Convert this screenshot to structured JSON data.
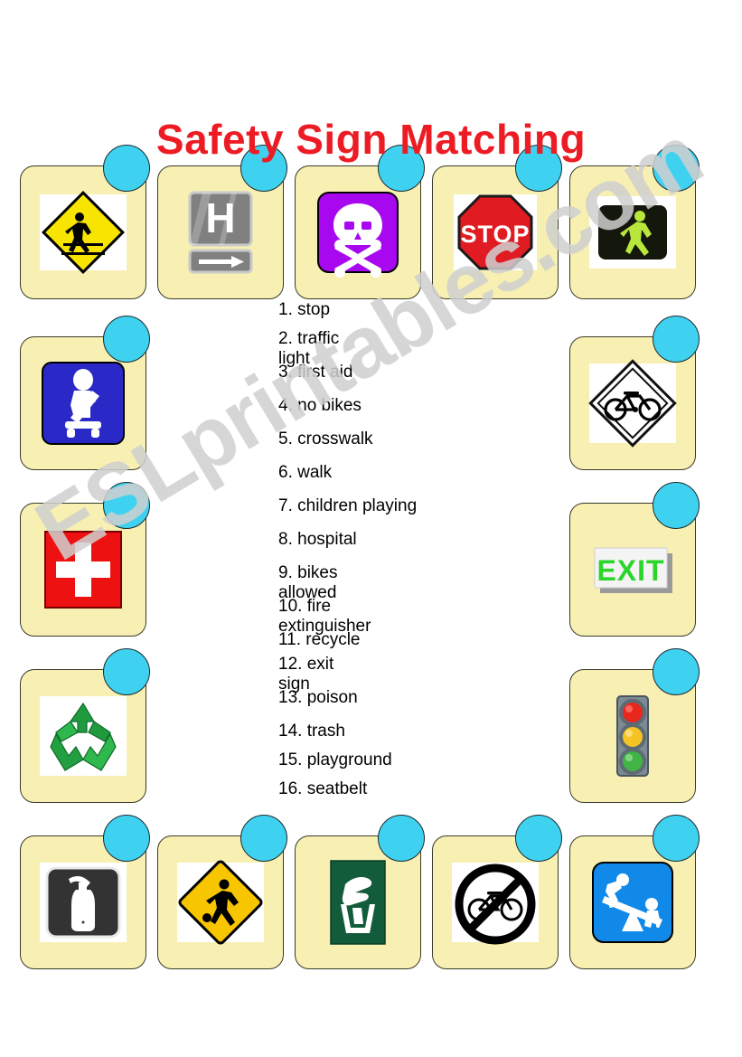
{
  "page": {
    "title": "Safety Sign Matching",
    "title_color": "#ED1C24",
    "background_color": "#ffffff",
    "watermark": "ESLprintables.com",
    "watermark_color": "#d0d0d0",
    "tile_color": "#F7F0B2",
    "bubble_color": "#3FD2F0"
  },
  "word_list": [
    {
      "num": "1.",
      "text": "stop"
    },
    {
      "num": "2.",
      "text": "traffic",
      "text2": "light"
    },
    {
      "num": "3.",
      "text": "first aid"
    },
    {
      "num": "4.",
      "text": "no bikes"
    },
    {
      "num": "5.",
      "text": "crosswalk"
    },
    {
      "num": "6.",
      "text": "walk"
    },
    {
      "num": "7.",
      "text": "children playing"
    },
    {
      "num": "8.",
      "text": "hospital"
    },
    {
      "num": "9.",
      "text": "bikes",
      "text2": "allowed"
    },
    {
      "num": "10.",
      "text": "fire",
      "text2": "extinguisher"
    },
    {
      "num": "11.",
      "text": "recycle"
    },
    {
      "num": "12.",
      "text": "exit",
      "text2": "sign"
    },
    {
      "num": "13.",
      "text": "poison"
    },
    {
      "num": "14.",
      "text": "trash"
    },
    {
      "num": "15.",
      "text": "playground"
    },
    {
      "num": "16.",
      "text": "seatbelt"
    }
  ],
  "signs": [
    {
      "id": "crosswalk",
      "name": "crosswalk-sign",
      "label": "crosswalk"
    },
    {
      "id": "hospital",
      "name": "hospital-sign",
      "label": "hospital"
    },
    {
      "id": "poison",
      "name": "poison-sign",
      "label": "poison"
    },
    {
      "id": "stop",
      "name": "stop-sign",
      "label": "stop"
    },
    {
      "id": "walk",
      "name": "walk-signal-sign",
      "label": "walk"
    },
    {
      "id": "seatbelt",
      "name": "seatbelt-sign",
      "label": "seatbelt"
    },
    {
      "id": "bikeroute",
      "name": "bikes-allowed-sign",
      "label": "bikes allowed"
    },
    {
      "id": "firstaid",
      "name": "first-aid-sign",
      "label": "first aid"
    },
    {
      "id": "exit",
      "name": "exit-sign",
      "label": "exit sign"
    },
    {
      "id": "recycle",
      "name": "recycle-sign",
      "label": "recycle"
    },
    {
      "id": "trafficlight",
      "name": "traffic-light-sign",
      "label": "traffic light"
    },
    {
      "id": "extinguisher",
      "name": "fire-extinguisher-sign",
      "label": "fire extinguisher"
    },
    {
      "id": "children",
      "name": "children-playing-sign",
      "label": "children playing"
    },
    {
      "id": "trash",
      "name": "trash-sign",
      "label": "trash"
    },
    {
      "id": "nobikes",
      "name": "no-bikes-sign",
      "label": "no bikes"
    },
    {
      "id": "playground",
      "name": "playground-sign",
      "label": "playground"
    }
  ],
  "sign_text": {
    "stop": "STOP",
    "hospital": "H",
    "exit": "EXIT"
  }
}
